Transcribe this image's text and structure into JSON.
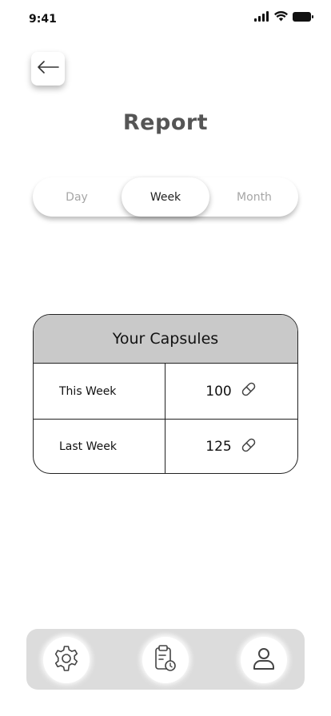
{
  "status_bar": {
    "time": "9:41"
  },
  "header": {
    "title": "Report"
  },
  "period_selector": {
    "options": [
      "Day",
      "Week",
      "Month"
    ],
    "selected": "Week"
  },
  "capsules_table": {
    "title": "Your Capsules",
    "rows": [
      {
        "label": "This Week",
        "value": "100",
        "icon": "pill-icon"
      },
      {
        "label": "Last Week",
        "value": "125",
        "icon": "pill-icon"
      }
    ]
  },
  "bottom_nav": {
    "items": [
      {
        "icon": "gear-icon"
      },
      {
        "icon": "clipboard-clock-icon"
      },
      {
        "icon": "user-icon"
      }
    ]
  }
}
